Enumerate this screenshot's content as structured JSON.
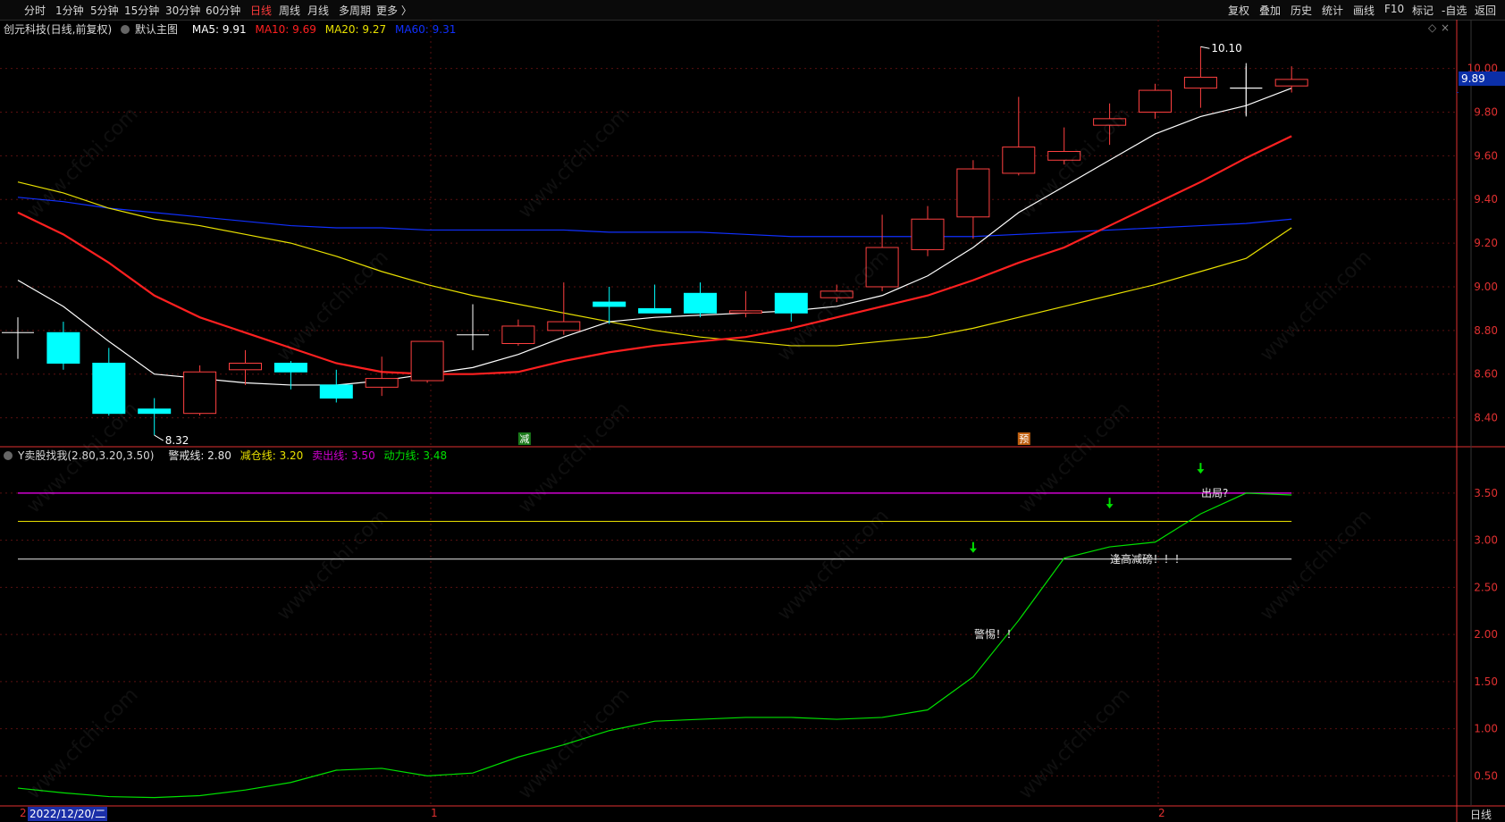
{
  "toolbar": {
    "left_items": [
      "分时",
      "1分钟",
      "5分钟",
      "15分钟",
      "30分钟",
      "60分钟",
      "日线",
      "周线",
      "月线",
      "多周期",
      "更多 〉"
    ],
    "active": "日线",
    "right_items": [
      "复权",
      "叠加",
      "历史",
      "统计",
      "画线",
      "F10",
      "标记",
      "-自选",
      "返回"
    ]
  },
  "main_pane": {
    "stock": "创元科技(日线,前复权)",
    "template": "默认主图",
    "ma5": "MA5: 9.91",
    "ma10": "MA10: 9.69",
    "ma20": "MA20: 9.27",
    "ma60": "MA60: 9.31",
    "current_price": "9.89",
    "high_label": "10.10",
    "low_label": "8.32",
    "signal_jian": "减",
    "signal_yu": "预",
    "y_ticks": [
      "10.00",
      "9.80",
      "9.60",
      "9.40",
      "9.20",
      "9.00",
      "8.80",
      "8.60",
      "8.40"
    ]
  },
  "sub_pane": {
    "indicator": "Y卖股找我(2.80,3.20,3.50)",
    "warn": "警戒线: 2.80",
    "reduce": "减仓线: 3.20",
    "sell": "卖出线: 3.50",
    "power": "动力线: 3.48",
    "y_ticks": [
      "3.50",
      "3.00",
      "2.50",
      "2.00",
      "1.50",
      "1.00",
      "0.50"
    ],
    "note_chuju": "出局?",
    "note_fenggao": "逢高减磅！！！",
    "note_jingti": "警惕！！"
  },
  "bottom": {
    "date": "2022/12/20/二",
    "period": "日线",
    "marker_left": "2",
    "marker_1": "1",
    "marker_2": "2"
  },
  "watermark": "www.cfchi.com",
  "colors": {
    "up": "#ff4040",
    "down": "#00ffff",
    "ma5": "#ffffff",
    "ma10": "#ff2020",
    "ma20": "#e8e000",
    "ma60": "#1030ff",
    "power": "#00e000",
    "sell_line": "#d000d0",
    "reduce_line": "#e8e000",
    "warn_line": "#e8e8e8",
    "axis": "#e03030"
  },
  "chart_data": {
    "type": "candlestick",
    "candles": [
      {
        "o": 8.79,
        "h": 8.86,
        "l": 8.67,
        "c": 8.79
      },
      {
        "o": 8.79,
        "h": 8.84,
        "l": 8.62,
        "c": 8.65
      },
      {
        "o": 8.65,
        "h": 8.72,
        "l": 8.41,
        "c": 8.42
      },
      {
        "o": 8.44,
        "h": 8.49,
        "l": 8.32,
        "c": 8.42
      },
      {
        "o": 8.42,
        "h": 8.64,
        "l": 8.41,
        "c": 8.61
      },
      {
        "o": 8.62,
        "h": 8.71,
        "l": 8.55,
        "c": 8.65
      },
      {
        "o": 8.65,
        "h": 8.66,
        "l": 8.53,
        "c": 8.61
      },
      {
        "o": 8.55,
        "h": 8.62,
        "l": 8.47,
        "c": 8.49
      },
      {
        "o": 8.54,
        "h": 8.68,
        "l": 8.5,
        "c": 8.58
      },
      {
        "o": 8.57,
        "h": 8.75,
        "l": 8.56,
        "c": 8.75
      },
      {
        "o": 8.78,
        "h": 8.92,
        "l": 8.71,
        "c": 8.78
      },
      {
        "o": 8.74,
        "h": 8.85,
        "l": 8.73,
        "c": 8.82
      },
      {
        "o": 8.8,
        "h": 9.02,
        "l": 8.78,
        "c": 8.84
      },
      {
        "o": 8.93,
        "h": 9.0,
        "l": 8.83,
        "c": 8.91
      },
      {
        "o": 8.9,
        "h": 9.01,
        "l": 8.88,
        "c": 8.88
      },
      {
        "o": 8.97,
        "h": 9.02,
        "l": 8.86,
        "c": 8.88
      },
      {
        "o": 8.88,
        "h": 8.98,
        "l": 8.86,
        "c": 8.89
      },
      {
        "o": 8.97,
        "h": 8.97,
        "l": 8.84,
        "c": 8.88
      },
      {
        "o": 8.95,
        "h": 9.01,
        "l": 8.93,
        "c": 8.98
      },
      {
        "o": 9.0,
        "h": 9.33,
        "l": 8.98,
        "c": 9.18
      },
      {
        "o": 9.17,
        "h": 9.37,
        "l": 9.14,
        "c": 9.31
      },
      {
        "o": 9.32,
        "h": 9.58,
        "l": 9.22,
        "c": 9.54
      },
      {
        "o": 9.52,
        "h": 9.87,
        "l": 9.51,
        "c": 9.64
      },
      {
        "o": 9.58,
        "h": 9.73,
        "l": 9.56,
        "c": 9.62
      },
      {
        "o": 9.74,
        "h": 9.84,
        "l": 9.65,
        "c": 9.77
      },
      {
        "o": 9.8,
        "h": 9.93,
        "l": 9.77,
        "c": 9.9
      },
      {
        "o": 9.91,
        "h": 10.1,
        "l": 9.82,
        "c": 9.96
      },
      {
        "o": 9.91,
        "h": 10.01,
        "l": 9.78,
        "c": 9.91
      },
      {
        "o": 9.92,
        "h": 10.01,
        "l": 9.89,
        "c": 9.95
      }
    ],
    "ma5": [
      9.03,
      8.91,
      8.75,
      8.6,
      8.58,
      8.56,
      8.55,
      8.55,
      8.57,
      8.6,
      8.63,
      8.69,
      8.77,
      8.84,
      8.86,
      8.87,
      8.88,
      8.89,
      8.91,
      8.96,
      9.05,
      9.18,
      9.34,
      9.46,
      9.58,
      9.7,
      9.78,
      9.83,
      9.91
    ],
    "ma10": [
      9.34,
      9.24,
      9.11,
      8.96,
      8.86,
      8.79,
      8.72,
      8.65,
      8.61,
      8.6,
      8.6,
      8.61,
      8.66,
      8.7,
      8.73,
      8.75,
      8.77,
      8.81,
      8.86,
      8.91,
      8.96,
      9.03,
      9.11,
      9.18,
      9.28,
      9.38,
      9.48,
      9.59,
      9.69
    ],
    "ma20": [
      9.48,
      9.43,
      9.36,
      9.31,
      9.28,
      9.24,
      9.2,
      9.14,
      9.07,
      9.01,
      8.96,
      8.92,
      8.88,
      8.84,
      8.8,
      8.77,
      8.75,
      8.73,
      8.73,
      8.75,
      8.77,
      8.81,
      8.86,
      8.91,
      8.96,
      9.01,
      9.07,
      9.13,
      9.27
    ],
    "ma60": [
      9.41,
      9.39,
      9.36,
      9.34,
      9.32,
      9.3,
      9.28,
      9.27,
      9.27,
      9.26,
      9.26,
      9.26,
      9.26,
      9.25,
      9.25,
      9.25,
      9.24,
      9.23,
      9.23,
      9.23,
      9.23,
      9.23,
      9.24,
      9.25,
      9.26,
      9.27,
      9.28,
      9.29,
      9.31
    ],
    "power": [
      0.37,
      0.32,
      0.28,
      0.27,
      0.29,
      0.35,
      0.43,
      0.56,
      0.58,
      0.5,
      0.53,
      0.7,
      0.83,
      0.98,
      1.08,
      1.1,
      1.12,
      1.12,
      1.1,
      1.12,
      1.2,
      1.55,
      2.15,
      2.81,
      2.93,
      2.98,
      3.28,
      3.5,
      3.48
    ],
    "y_range_main": [
      8.3,
      10.15
    ],
    "y_range_sub": [
      0.2,
      3.85
    ],
    "levels": {
      "warn": 2.8,
      "reduce": 3.2,
      "sell": 3.5
    }
  }
}
